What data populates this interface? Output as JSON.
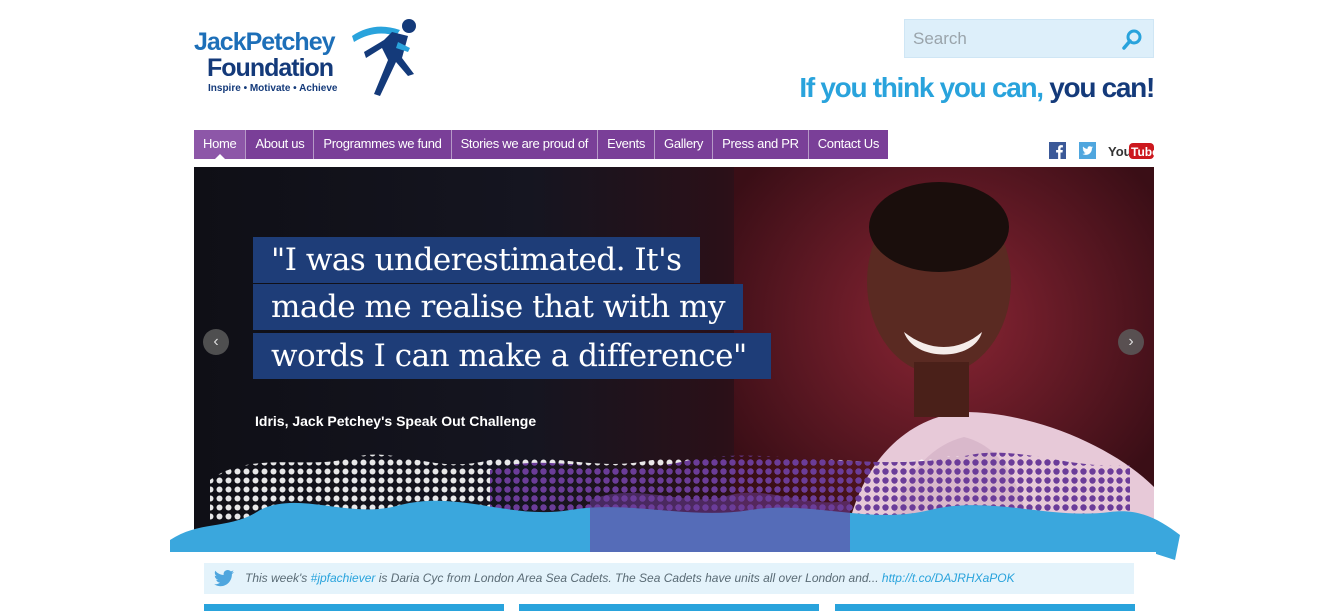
{
  "header": {
    "logo": {
      "line1_a": "Jack",
      "line1_b": "Petchey",
      "line2": "Foundation",
      "tagline": "Inspire • Motivate • Achieve"
    },
    "search": {
      "placeholder": "Search"
    },
    "slogan": {
      "part1": "If you think you can,",
      "part2": "you can!"
    }
  },
  "nav": {
    "items": [
      {
        "label": "Home"
      },
      {
        "label": "About us"
      },
      {
        "label": "Programmes we fund"
      },
      {
        "label": "Stories we are proud of"
      },
      {
        "label": "Events"
      },
      {
        "label": "Gallery"
      },
      {
        "label": "Press and PR"
      },
      {
        "label": "Contact Us"
      }
    ],
    "active": "Home"
  },
  "social": {
    "icons": [
      "facebook-icon",
      "twitter-icon",
      "youtube-icon"
    ],
    "youtube_text_a": "You",
    "youtube_text_b": "Tube"
  },
  "hero": {
    "quote_line1": "\"I was underestimated. It's",
    "quote_line2": "made me realise that with my",
    "quote_line3": "words I can make a difference\"",
    "caption": "Idris, Jack Petchey's Speak Out Challenge",
    "prev_icon": "chevron-left-icon",
    "next_icon": "chevron-right-icon"
  },
  "tweet": {
    "prefix": "This week's ",
    "hashtag": "#jpfachiever",
    "body": " is Daria Cyc from London Area Sea Cadets. The Sea Cadets have units all over London and... ",
    "link": "http://t.co/DAJRHXaPOK"
  },
  "colors": {
    "nav_purple": "#7a3f98",
    "brand_blue": "#29a3dc",
    "brand_navy": "#143a7a",
    "quote_bg": "#1e3d78"
  }
}
